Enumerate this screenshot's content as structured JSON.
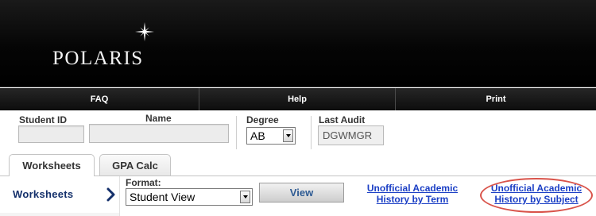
{
  "app": {
    "logo_text": "POLARIS"
  },
  "nav": {
    "items": [
      "FAQ",
      "Help",
      "Print"
    ]
  },
  "student": {
    "id_label": "Student ID",
    "id_value": "",
    "name_label": "Name",
    "name_value": "",
    "degree_label": "Degree",
    "degree_value": "AB",
    "last_audit_label": "Last Audit",
    "last_audit_value": "DGWMGR"
  },
  "tabs": [
    "Worksheets",
    "GPA Calc"
  ],
  "worksheets": {
    "title": "Worksheets",
    "format_label": "Format:",
    "format_value": "Student View",
    "view_button": "View",
    "link_by_term_line1": "Unofficial Academic",
    "link_by_term_line2": "History by Term",
    "link_by_subject_line1": "Unofficial Academic",
    "link_by_subject_line2": "History by Subject"
  },
  "colors": {
    "header_bg": "#000000",
    "link": "#1a3ec5",
    "highlight_ring": "#d9534a",
    "worksheets_title": "#14306b"
  },
  "icons": {
    "logo_star": "star-icon",
    "section_arrow": "chevron-right-icon",
    "dropdown_arrow": "chevron-down-icon"
  }
}
